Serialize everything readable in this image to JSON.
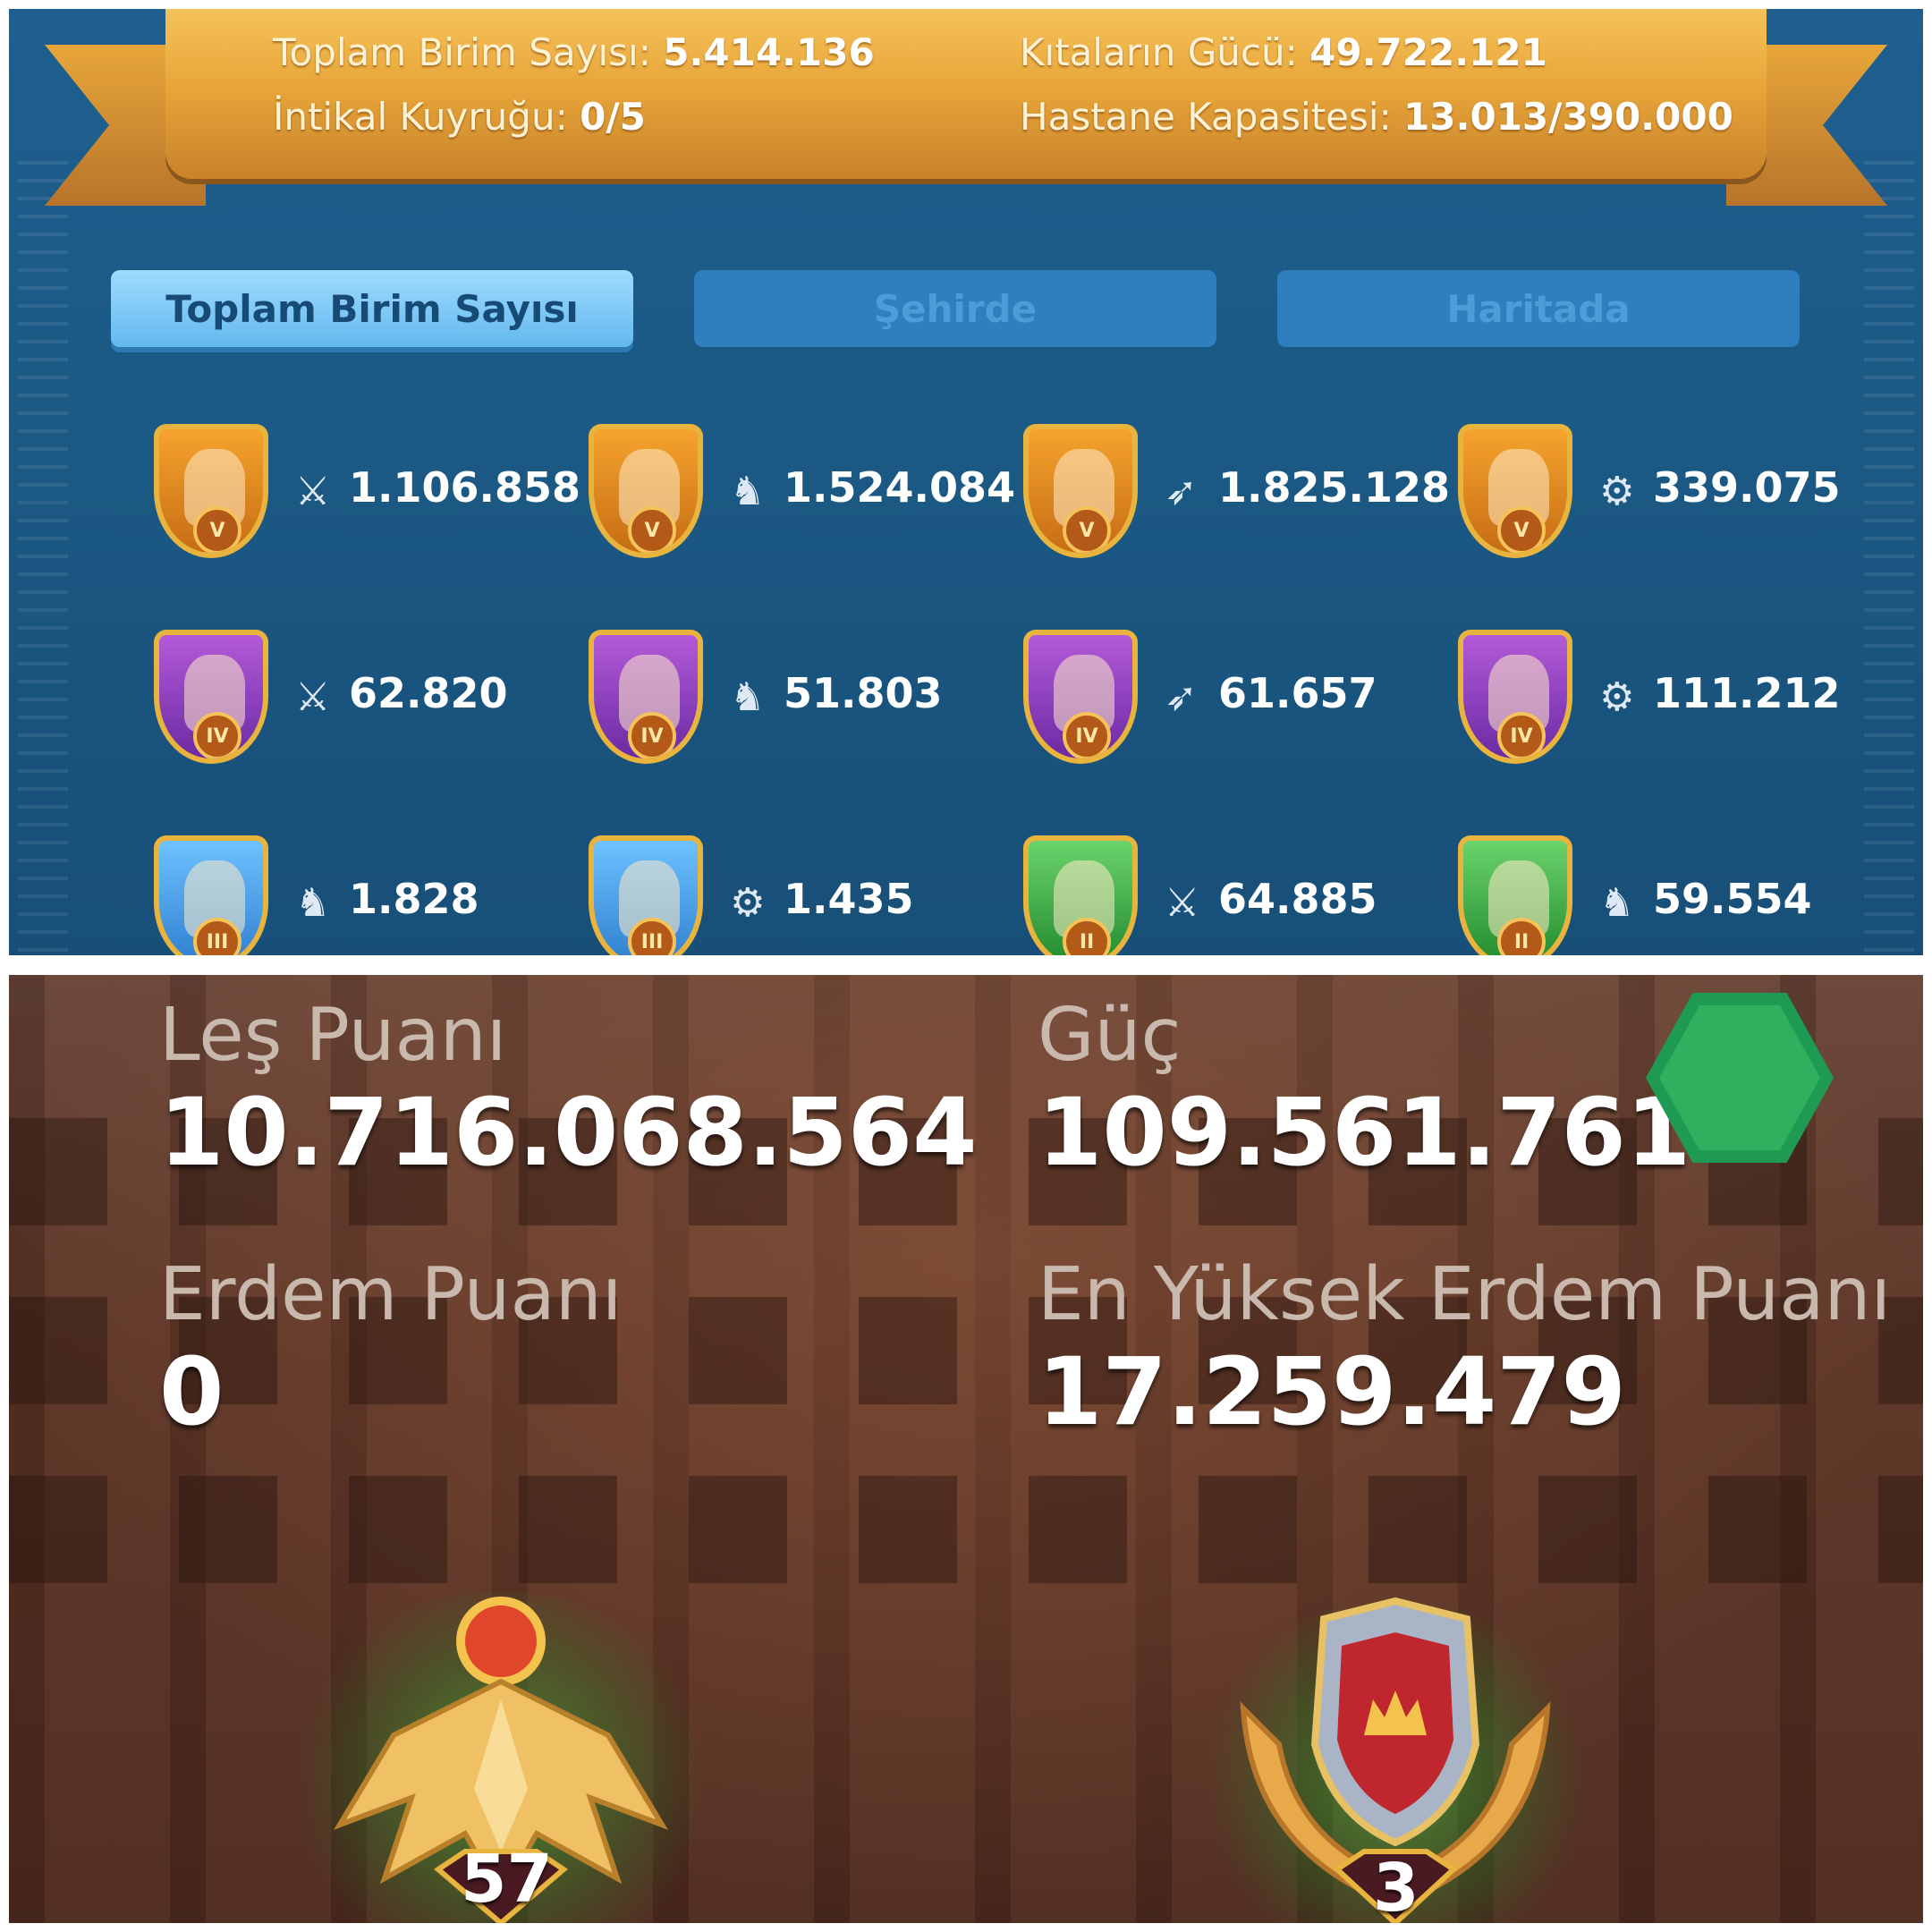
{
  "army": {
    "ribbon": {
      "total_units_label": "Toplam Birim Sayısı:",
      "total_units_value": "5.414.136",
      "transfer_queue_label": "İntikal Kuyruğu:",
      "transfer_queue_value": "0/5",
      "continent_power_label": "Kıtaların Gücü:",
      "continent_power_value": "49.722.121",
      "hospital_label": "Hastane Kapasitesi:",
      "hospital_value": "13.013/390.000"
    },
    "tabs": [
      {
        "label": "Toplam Birim Sayısı",
        "active": true
      },
      {
        "label": "Şehirde",
        "active": false
      },
      {
        "label": "Haritada",
        "active": false
      }
    ],
    "units": [
      {
        "tier": "V",
        "type": "infantry",
        "type_icon": "sword-icon",
        "count": "1.106.858",
        "color": "gold"
      },
      {
        "tier": "V",
        "type": "cavalry",
        "type_icon": "horse-icon",
        "count": "1.524.084",
        "color": "gold"
      },
      {
        "tier": "V",
        "type": "archer",
        "type_icon": "bow-icon",
        "count": "1.825.128",
        "color": "gold"
      },
      {
        "tier": "V",
        "type": "siege",
        "type_icon": "siege-icon",
        "count": "339.075",
        "color": "gold"
      },
      {
        "tier": "IV",
        "type": "infantry",
        "type_icon": "sword-icon",
        "count": "62.820",
        "color": "purple"
      },
      {
        "tier": "IV",
        "type": "cavalry",
        "type_icon": "horse-icon",
        "count": "51.803",
        "color": "purple"
      },
      {
        "tier": "IV",
        "type": "archer",
        "type_icon": "bow-icon",
        "count": "61.657",
        "color": "purple"
      },
      {
        "tier": "IV",
        "type": "siege",
        "type_icon": "siege-icon",
        "count": "111.212",
        "color": "purple"
      },
      {
        "tier": "III",
        "type": "cavalry",
        "type_icon": "horse-icon",
        "count": "1.828",
        "color": "blue"
      },
      {
        "tier": "III",
        "type": "siege",
        "type_icon": "siege-icon",
        "count": "1.435",
        "color": "blue"
      },
      {
        "tier": "II",
        "type": "infantry",
        "type_icon": "sword-icon",
        "count": "64.885",
        "color": "green"
      },
      {
        "tier": "II",
        "type": "cavalry",
        "type_icon": "horse-icon",
        "count": "59.554",
        "color": "green"
      }
    ]
  },
  "profile": {
    "kill_points_label": "Leş Puanı",
    "kill_points_value": "10.716.068.564",
    "power_label": "Güç",
    "power_value": "109.561.761",
    "merit_label": "Erdem Puanı",
    "merit_value": "0",
    "highest_merit_label": "En Yüksek Erdem Puanı",
    "highest_merit_value": "17.259.479",
    "vip_level": "57",
    "rank_level": "3",
    "colors": {
      "hex_badge": "#1f9a52",
      "glow": "#3cc83c"
    }
  }
}
